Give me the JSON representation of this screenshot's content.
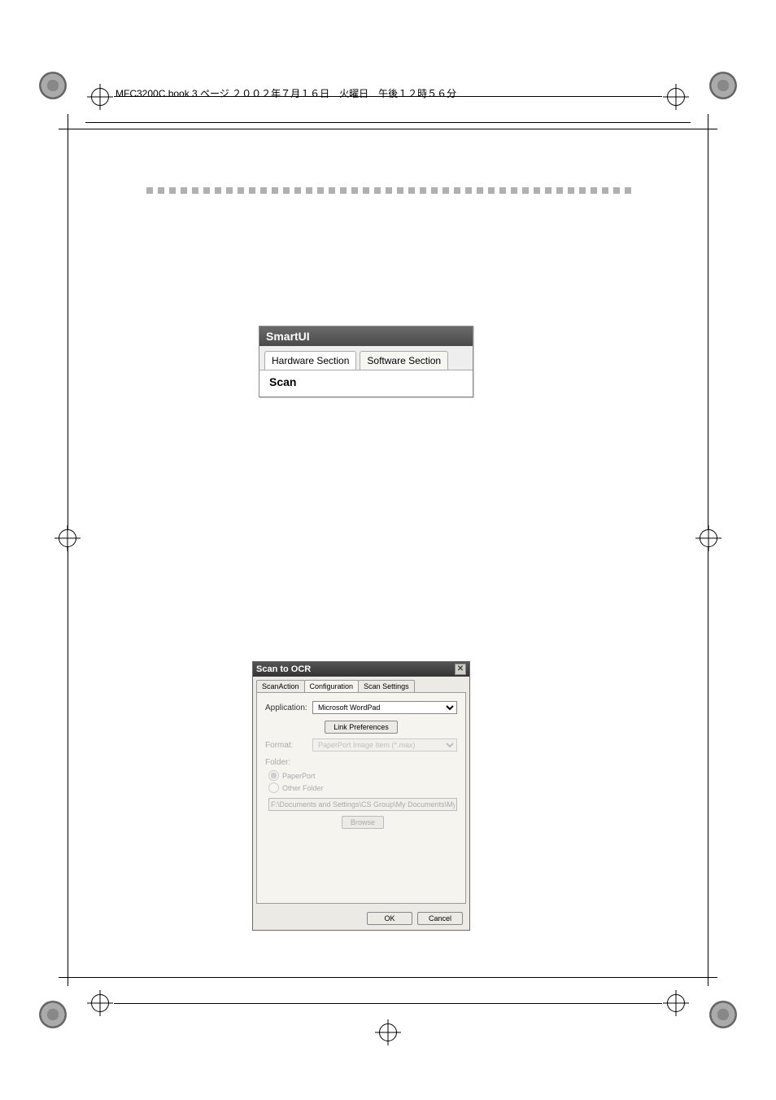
{
  "header": {
    "book_line": "MFC3200C.book  3 ページ  ２００２年７月１６日　火曜日　午後１２時５６分"
  },
  "smartui": {
    "title": "SmartUI",
    "tabs": {
      "hardware": "Hardware Section",
      "software": "Software Section"
    },
    "body_label": "Scan"
  },
  "dialog": {
    "title": "Scan to OCR",
    "close_glyph": "✕",
    "tabs": {
      "scanaction": "ScanAction",
      "configuration": "Configuration",
      "scansettings": "Scan Settings"
    },
    "labels": {
      "application": "Application:",
      "format": "Format:",
      "folder": "Folder:",
      "paperport": "PaperPort",
      "otherfolder": "Other Folder"
    },
    "values": {
      "application": "Microsoft WordPad",
      "format": "PaperPort Image Item (*.max)",
      "path": "F:\\Documents and Settings\\CS Group\\My Documents\\My P"
    },
    "buttons": {
      "linkprefs": "Link Preferences",
      "browse": "Browse",
      "ok": "OK",
      "cancel": "Cancel"
    }
  }
}
